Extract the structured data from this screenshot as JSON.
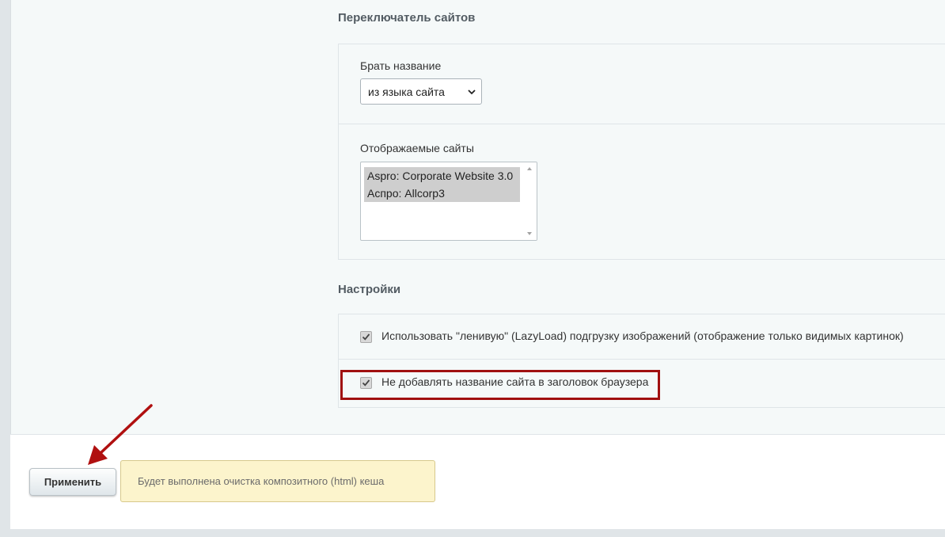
{
  "site_switcher": {
    "title": "Переключатель сайтов",
    "name_source_label": "Брать название",
    "name_source_value": "из языка сайта",
    "displayed_sites_label": "Отображаемые сайты",
    "displayed_sites": [
      "Aspro: Corporate Website 3.0",
      "Аспро: Allcorp3"
    ]
  },
  "settings": {
    "title": "Настройки",
    "lazyload_label": "Использовать \"ленивую\" (LazyLoad) подгрузку изображений (отображение только видимых картинок)",
    "lazyload_checked": true,
    "no_site_name_label": "Не добавлять название сайта в заголовок браузера",
    "no_site_name_checked": true
  },
  "footer": {
    "apply_label": "Применить",
    "notice_text": "Будет выполнена очистка композитного (html) кеша"
  },
  "colors": {
    "highlight_border": "#a01010",
    "notice_background": "#fcf4cc"
  },
  "icons": {
    "checkbox_mark": "check-icon",
    "select_toggle": "chevron-down-icon",
    "annotation": "red-arrow-icon"
  }
}
